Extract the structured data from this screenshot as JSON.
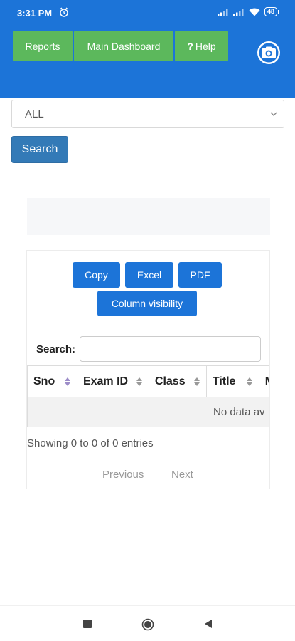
{
  "status_bar": {
    "time": "3:31 PM",
    "battery": "48"
  },
  "nav": {
    "reports_label": "Reports",
    "dashboard_label": "Main Dashboard",
    "help_label": "Help",
    "help_prefix": "?"
  },
  "filter": {
    "selected": "ALL"
  },
  "search_button_label": "Search",
  "export_buttons": {
    "copy": "Copy",
    "excel": "Excel",
    "pdf": "PDF",
    "column_visibility": "Column visibility"
  },
  "table_search_label": "Search:",
  "table": {
    "columns": [
      "Sno",
      "Exam ID",
      "Class",
      "Title",
      "M"
    ],
    "empty_message": "No data av",
    "info": "Showing 0 to 0 of 0 entries"
  },
  "pagination": {
    "previous": "Previous",
    "next": "Next"
  },
  "colors": {
    "header": "#1c74d8",
    "nav_button": "#5cb85c",
    "search_button": "#337ab7",
    "export_button": "#1c74d8"
  }
}
